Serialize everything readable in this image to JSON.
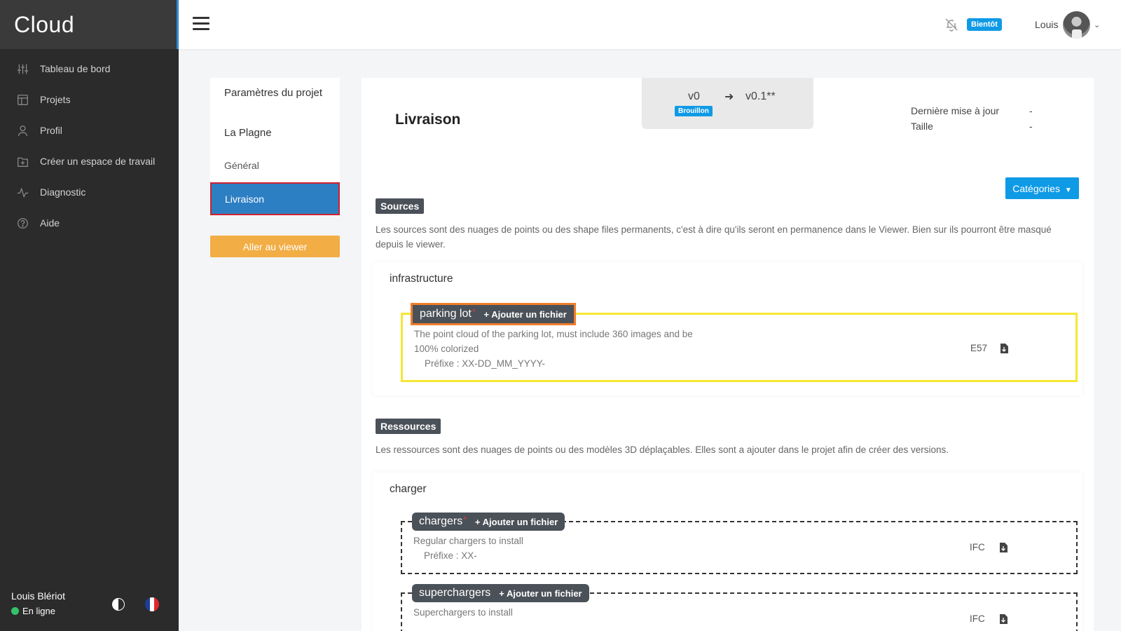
{
  "app": {
    "brand": "Cloud"
  },
  "sidebar": {
    "items": [
      {
        "label": "Tableau de bord",
        "icon": "sliders-icon"
      },
      {
        "label": "Projets",
        "icon": "layout-icon"
      },
      {
        "label": "Profil",
        "icon": "user-icon"
      },
      {
        "label": "Créer un espace de travail",
        "icon": "folder-plus-icon"
      },
      {
        "label": "Diagnostic",
        "icon": "activity-icon"
      },
      {
        "label": "Aide",
        "icon": "help-circle-icon"
      }
    ],
    "user_name": "Louis Blériot",
    "user_status": "En ligne",
    "status_color": "#33c26b"
  },
  "topbar": {
    "badge": "Bientôt",
    "user": "Louis"
  },
  "project_nav": {
    "title": "Paramètres du projet",
    "project_name": "La Plagne",
    "general": "Général",
    "active": "Livraison",
    "viewer_button": "Aller au viewer"
  },
  "main": {
    "title": "Livraison",
    "version_from": "v0",
    "version_to": "v0.1**",
    "draft_badge": "Brouillon",
    "last_update_label": "Dernière mise à jour",
    "last_update_value": "-",
    "size_label": "Taille",
    "size_value": "-",
    "categories_button": "Catégories"
  },
  "sources": {
    "tag": "Sources",
    "description": "Les sources sont des nuages de points ou des shape files permanents, c'est à dire qu'ils seront en permanence dans le Viewer. Bien sur ils pourront être masqué depuis le viewer.",
    "group": "infrastructure",
    "files": [
      {
        "name": "parking lot",
        "required": "*",
        "add": "+ Ajouter un fichier",
        "description_line1": "The point cloud of the parking lot, must include 360 images and be",
        "description_line2": "100% colorized",
        "prefix": "Préfixe : XX-DD_MM_YYYY-",
        "format": "E57"
      }
    ]
  },
  "resources": {
    "tag": "Ressources",
    "description": "Les ressources sont des nuages de points ou des modèles 3D déplaçables. Elles sont a ajouter dans le projet afin de créer des versions.",
    "group": "charger",
    "files": [
      {
        "name": "chargers",
        "required": "*",
        "add": "+ Ajouter un fichier",
        "description": "Regular chargers to install",
        "prefix": "Préfixe : XX-",
        "format": "IFC"
      },
      {
        "name": "superchargers",
        "add": "+ Ajouter un fichier",
        "description": "Superchargers to install",
        "format": "IFC"
      }
    ]
  },
  "colors": {
    "sidebar_bg": "#2b2b2b",
    "accent_blue": "#0f9ae6",
    "active_blue": "#2d7fc3",
    "viewer_orange": "#f2ad45",
    "highlight_yellow": "#f6e733",
    "highlight_red": "#d0212f"
  }
}
